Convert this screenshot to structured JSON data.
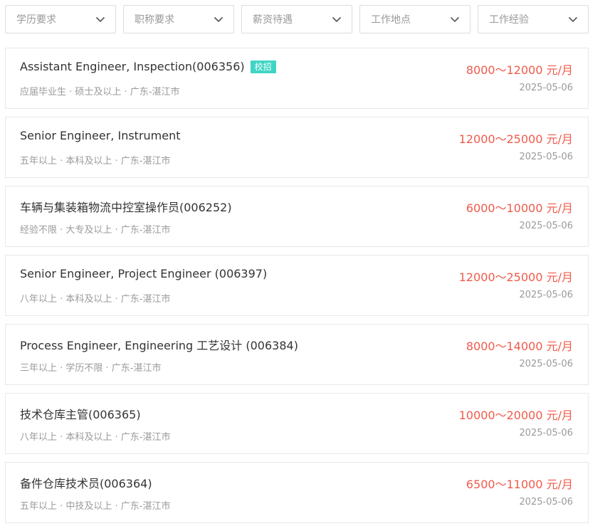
{
  "filters": [
    {
      "label": "学历要求",
      "icon": "chevron-down-icon"
    },
    {
      "label": "职称要求",
      "icon": "chevron-down-icon"
    },
    {
      "label": "薪资待遇",
      "icon": "chevron-down-icon"
    },
    {
      "label": "工作地点",
      "icon": "chevron-down-icon"
    },
    {
      "label": "工作经验",
      "icon": "chevron-down-icon"
    }
  ],
  "colors": {
    "salary": "#f05a4a",
    "tag_bg": "#3fd5c4",
    "meta_text": "#9a9a9a",
    "border": "#e8e8e8"
  },
  "jobs": [
    {
      "title": "Assistant Engineer, Inspection(006356)",
      "tag": "校招",
      "meta": "应届毕业生 · 硕士及以上 · 广东-湛江市",
      "salary": "8000～12000 元/月",
      "date": "2025-05-06"
    },
    {
      "title": "Senior Engineer, Instrument",
      "tag": "",
      "meta": "五年以上 · 本科及以上 · 广东-湛江市",
      "salary": "12000～25000 元/月",
      "date": "2025-05-06"
    },
    {
      "title": "车辆与集装箱物流中控室操作员(006252)",
      "tag": "",
      "meta": "经验不限 · 大专及以上 · 广东-湛江市",
      "salary": "6000～10000 元/月",
      "date": "2025-05-06"
    },
    {
      "title": "Senior Engineer, Project Engineer (006397)",
      "tag": "",
      "meta": "八年以上 · 本科及以上 · 广东-湛江市",
      "salary": "12000～25000 元/月",
      "date": "2025-05-06"
    },
    {
      "title": "Process Engineer, Engineering 工艺设计 (006384)",
      "tag": "",
      "meta": "三年以上 · 学历不限 · 广东-湛江市",
      "salary": "8000～14000 元/月",
      "date": "2025-05-06"
    },
    {
      "title": "技术仓库主管(006365)",
      "tag": "",
      "meta": "八年以上 · 本科及以上 · 广东-湛江市",
      "salary": "10000～20000 元/月",
      "date": "2025-05-06"
    },
    {
      "title": "备件仓库技术员(006364)",
      "tag": "",
      "meta": "五年以上 · 中技及以上 · 广东-湛江市",
      "salary": "6500～11000 元/月",
      "date": "2025-05-06"
    }
  ]
}
